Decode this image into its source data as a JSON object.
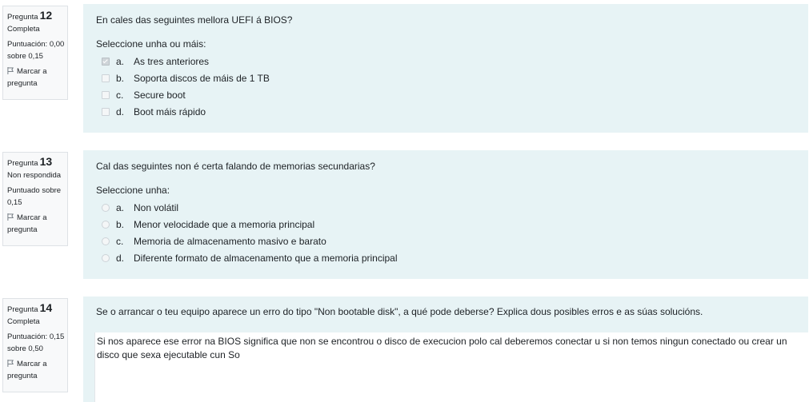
{
  "questions": [
    {
      "label": "Pregunta",
      "number": "12",
      "state": "Completa",
      "grade_line1": "Puntuación: 0,00",
      "grade_line2": "sobre 0,15",
      "flag_label_1": "Marcar a",
      "flag_label_2": "pregunta",
      "text": "En cales das seguintes mellora UEFI á BIOS?",
      "prompt": "Seleccione unha ou máis:",
      "answers": [
        {
          "letter": "a.",
          "text": "As tres anteriores",
          "checked": true
        },
        {
          "letter": "b.",
          "text": "Soporta discos de máis de 1 TB",
          "checked": false
        },
        {
          "letter": "c.",
          "text": "Secure boot",
          "checked": false
        },
        {
          "letter": "d.",
          "text": "Boot máis rápido",
          "checked": false
        }
      ]
    },
    {
      "label": "Pregunta",
      "number": "13",
      "state": "Non respondida",
      "grade_line1": "Puntuado sobre",
      "grade_line2": "0,15",
      "flag_label_1": "Marcar a",
      "flag_label_2": "pregunta",
      "text": "Cal das seguintes non é certa falando de memorias secundarias?",
      "prompt": "Seleccione unha:",
      "answers": [
        {
          "letter": "a.",
          "text": "Non volátil",
          "checked": false
        },
        {
          "letter": "b.",
          "text": "Menor velocidade que a memoria principal",
          "checked": false
        },
        {
          "letter": "c.",
          "text": "Memoria de almacenamento masivo e barato",
          "checked": false
        },
        {
          "letter": "d.",
          "text": "Diferente formato de almacenamento que a memoria principal",
          "checked": false
        }
      ]
    },
    {
      "label": "Pregunta",
      "number": "14",
      "state": "Completa",
      "grade_line1": "Puntuación: 0,15",
      "grade_line2": "sobre 0,50",
      "flag_label_1": "Marcar a",
      "flag_label_2": "pregunta",
      "text": "Se o arrancar o teu equipo aparece un erro do tipo \"Non bootable disk\", a qué pode deberse? Explica dous posibles erros e as súas solucións.",
      "response": "Si nos aparece ese error na BIOS significa que non se encontrou o disco de execucion polo cal deberemos conectar u si non temos ningun conectado ou crear un disco que sexa ejecutable cun So"
    }
  ]
}
